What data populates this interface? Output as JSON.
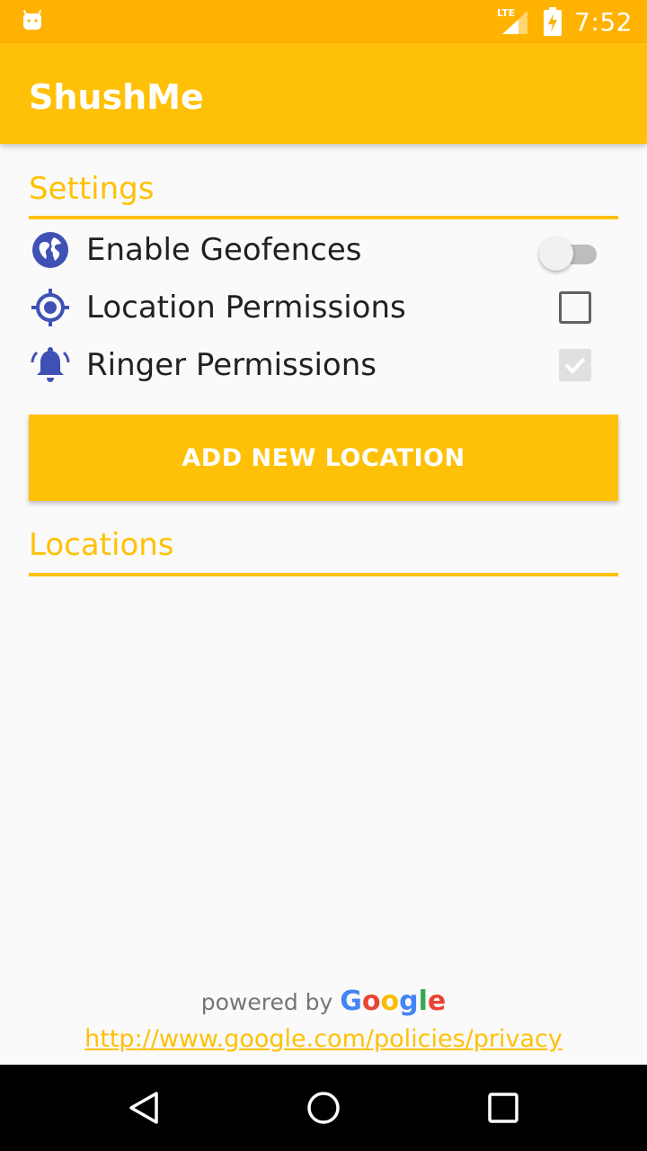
{
  "status_bar": {
    "time": "7:52",
    "network": "LTE",
    "icons": [
      "android-icon",
      "lte-signal-icon",
      "battery-charging-icon"
    ]
  },
  "app_bar": {
    "title": "ShushMe"
  },
  "settings": {
    "header": "Settings",
    "items": [
      {
        "label": "Enable Geofences",
        "icon": "globe-icon",
        "control": "toggle",
        "state": "off"
      },
      {
        "label": "Location Permissions",
        "icon": "gps-icon",
        "control": "checkbox",
        "state": "unchecked"
      },
      {
        "label": "Ringer Permissions",
        "icon": "bell-icon",
        "control": "checkbox",
        "state": "checked-disabled"
      }
    ]
  },
  "add_button": {
    "label": "ADD NEW LOCATION"
  },
  "locations": {
    "header": "Locations"
  },
  "footer": {
    "powered_by": "powered by",
    "google": [
      "G",
      "o",
      "o",
      "g",
      "l",
      "e"
    ],
    "privacy_link": "http://www.google.com/policies/privacy"
  },
  "nav_bar": {
    "buttons": [
      "back-icon",
      "home-icon",
      "recents-icon"
    ]
  },
  "colors": {
    "primary": "#FFC107",
    "primary_dark": "#FFB300",
    "icon": "#3F51B5"
  }
}
